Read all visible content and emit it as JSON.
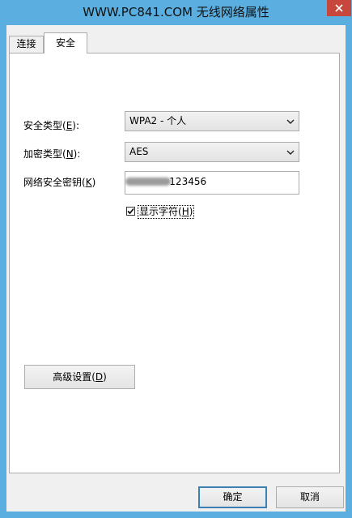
{
  "window": {
    "title": "WWW.PC841.COM 无线网络属性",
    "close_label": "✕"
  },
  "tabs": [
    {
      "label": "连接",
      "active": false
    },
    {
      "label": "安全",
      "active": true
    }
  ],
  "security": {
    "security_type": {
      "label_prefix": "安全类型(",
      "accel": "E",
      "label_suffix": "):",
      "value": "WPA2 - 个人"
    },
    "encryption_type": {
      "label_prefix": "加密类型(",
      "accel": "N",
      "label_suffix": "):",
      "value": "AES"
    },
    "network_key": {
      "label_prefix": "网络安全密钥(",
      "accel": "K",
      "label_suffix": ")",
      "visible_value": "123456"
    },
    "show_characters": {
      "label_prefix": "显示字符(",
      "accel": "H",
      "label_suffix": ")",
      "checked": true
    }
  },
  "buttons": {
    "advanced": {
      "prefix": "高级设置(",
      "accel": "D",
      "suffix": ")"
    },
    "ok": "确定",
    "cancel": "取消"
  },
  "colors": {
    "titlebar": "#5aaee0",
    "close_button": "#c7473c",
    "dialog_background": "#f0f0f0",
    "default_button_border": "#3c7fb1"
  }
}
